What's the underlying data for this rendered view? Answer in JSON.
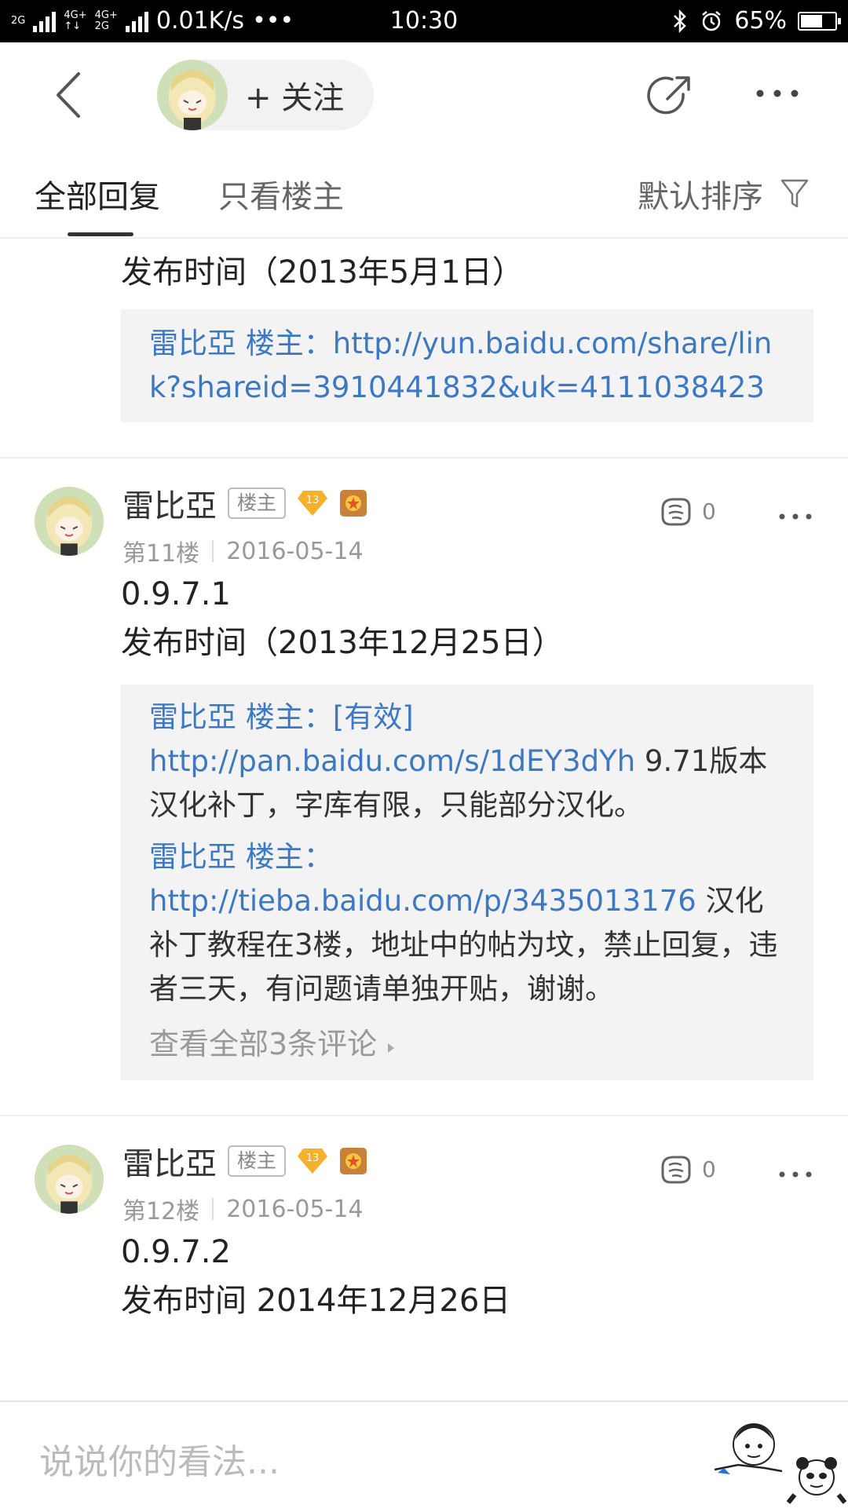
{
  "status_bar": {
    "net1": "2G",
    "net2_top": "4G+",
    "net2_bottom": "↑↓",
    "net3_top": "4G+",
    "net3_bottom": "2G",
    "speed": "0.01K/s",
    "dots": "•••",
    "time": "10:30",
    "battery": "65%",
    "battery_level": 0.65
  },
  "nav": {
    "follow_label": "+ 关注"
  },
  "tabs": {
    "all_replies": "全部回复",
    "owner_only": "只看楼主",
    "sort_label": "默认排序"
  },
  "top_fragment": {
    "text": "发布时间（2013年5月1日）",
    "quote_author": "雷比亞 楼主：",
    "quote_link": "http://yun.baidu.com/share/link?shareid=3910441832&uk=4111038423"
  },
  "posts": [
    {
      "author": "雷比亞",
      "owner_badge": "楼主",
      "level": "13",
      "floor": "第11楼",
      "date": "2016-05-14",
      "likes": "0",
      "line1": "0.9.7.1",
      "line2": "发布时间（2013年12月25日）",
      "replies": [
        {
          "author": "雷比亞 楼主：",
          "link": "[有效] http://pan.baidu.com/s/1dEY3dYh",
          "text": " 9.71版本汉化补丁，字库有限，只能部分汉化。"
        },
        {
          "author": "雷比亞 楼主：",
          "link": "http://tieba.baidu.com/p/3435013176",
          "text": " 汉化补丁教程在3楼，地址中的帖为坟，禁止回复，违者三天，有问题请单独开贴，谢谢。"
        }
      ],
      "view_all": "查看全部3条评论"
    },
    {
      "author": "雷比亞",
      "owner_badge": "楼主",
      "level": "13",
      "floor": "第12楼",
      "date": "2016-05-14",
      "likes": "0",
      "line1": "0.9.7.2",
      "line2": "发布时间 2014年12月26日"
    }
  ],
  "bottom": {
    "placeholder": "说说你的看法..."
  },
  "colors": {
    "link_blue": "#3d78c2",
    "quote_bg": "#f3f3f3"
  }
}
